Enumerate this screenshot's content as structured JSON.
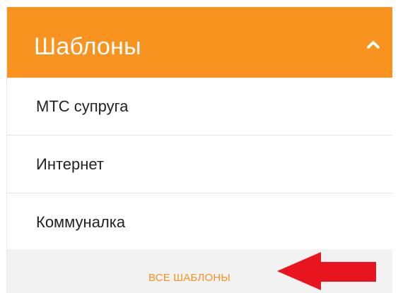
{
  "templates_panel": {
    "title": "Шаблоны",
    "collapse_icon": "chevron-up-icon",
    "header_color": "#f7931e",
    "items": [
      {
        "label": "МТС супруга"
      },
      {
        "label": "Интернет"
      },
      {
        "label": "Коммуналка"
      }
    ],
    "all_link_label": "ВСЕ ШАБЛОНЫ",
    "all_link_color": "#f7931e"
  },
  "annotation": {
    "arrow_icon": "red-arrow-left-icon",
    "arrow_color": "#e8141e"
  }
}
